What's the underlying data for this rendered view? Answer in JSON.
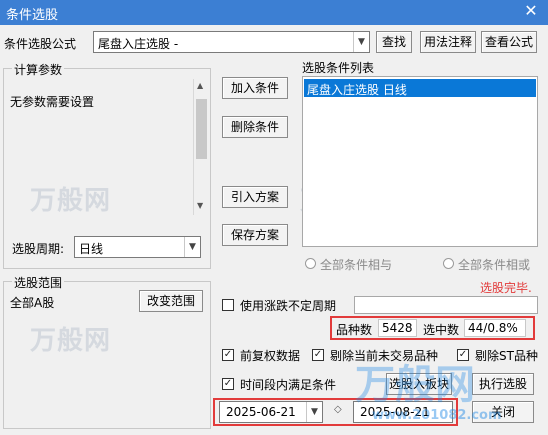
{
  "window": {
    "title": "条件选股",
    "close_glyph": "✕"
  },
  "formula": {
    "label": "条件选股公式",
    "value": "尾盘入庄选股  -",
    "find_btn": "查找",
    "usage_btn": "用法注释",
    "view_btn": "查看公式"
  },
  "params": {
    "group_title": "计算参数",
    "text": "无参数需要设置"
  },
  "period": {
    "label": "选股周期:",
    "value": "日线"
  },
  "scope": {
    "group_title": "选股范围",
    "value": "全部A股",
    "change_btn": "改变范围"
  },
  "actions": {
    "add": "加入条件",
    "delete": "删除条件",
    "import": "引入方案",
    "save": "保存方案"
  },
  "conditions": {
    "title": "选股条件列表",
    "items": [
      "尾盘入庄选股  日线"
    ],
    "radio_and": "全部条件相与",
    "radio_or": "全部条件相或"
  },
  "status": {
    "done": "选股完毕."
  },
  "options": {
    "variable_period": "使用涨跌不定周期",
    "pre_adjust": "前复权数据",
    "exclude_untraded": "剔除当前未交易品种",
    "exclude_st": "剔除ST品种",
    "time_range": "时间段内满足条件"
  },
  "stats": {
    "count_label": "品种数",
    "count_value": "5428",
    "selected_label": "选中数",
    "selected_value": "44/0.8%"
  },
  "dates": {
    "start": "2025-06-21",
    "end": "2025-08-21"
  },
  "bottom": {
    "select_to_block": "选股入板块",
    "run": "执行选股",
    "close": "关闭"
  },
  "watermark": {
    "brand": "万般网",
    "url": "www.201082.com"
  },
  "colors": {
    "accent": "#3c7fd3",
    "selection": "#0a78d7",
    "highlight_box": "#e23b3b",
    "status_red": "#e23b3b"
  }
}
